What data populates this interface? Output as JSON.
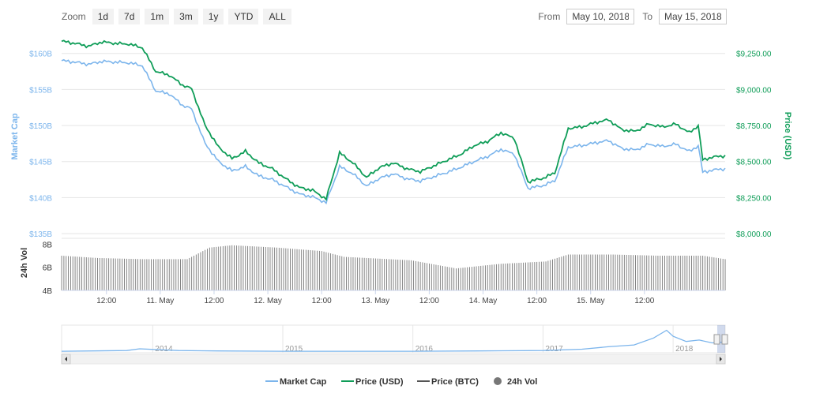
{
  "toolbar": {
    "zoom_label": "Zoom",
    "zoom_buttons": [
      "1d",
      "7d",
      "1m",
      "3m",
      "1y",
      "YTD",
      "ALL"
    ],
    "from_label": "From",
    "from_value": "May 10, 2018",
    "to_label": "To",
    "to_value": "May 15, 2018"
  },
  "colors": {
    "market_cap": "#7cb5ec",
    "price_usd": "#0f9d58",
    "price_btc": "#555555",
    "volume": "#777777",
    "grid": "#e6e6e6"
  },
  "chart_data": {
    "type": "line",
    "title": "",
    "axes": {
      "left_title": "Market Cap",
      "right_title": "Price (USD)",
      "volume_title": "24h Vol",
      "left_ticks": [
        "$160B",
        "$155B",
        "$150B",
        "$145B",
        "$140B",
        "$135B"
      ],
      "left_tick_values": [
        160,
        155,
        150,
        145,
        140,
        135
      ],
      "right_ticks": [
        "$9,250.00",
        "$9,000.00",
        "$8,750.00",
        "$8,500.00",
        "$8,250.00",
        "$8,000.00"
      ],
      "right_tick_values": [
        9250,
        9000,
        8750,
        8500,
        8250,
        8000
      ],
      "volume_ticks": [
        "8B",
        "6B",
        "4B"
      ],
      "volume_tick_values": [
        8,
        6,
        4
      ],
      "x_ticks": [
        "12:00",
        "11. May",
        "12:00",
        "12. May",
        "12:00",
        "13. May",
        "12:00",
        "14. May",
        "12:00",
        "15. May",
        "12:00"
      ],
      "x_tick_hours": [
        12,
        24,
        36,
        48,
        60,
        72,
        84,
        96,
        108,
        120,
        132
      ],
      "x_range_hours": [
        2,
        150
      ],
      "price_range": [
        8000,
        9380
      ],
      "volume_range": [
        4,
        8.5
      ],
      "grid": true
    },
    "series": [
      {
        "name": "Price (USD)",
        "x_hours": [
          2,
          5,
          8,
          11,
          14,
          17,
          20,
          23,
          26,
          29,
          31,
          34,
          37,
          40,
          43,
          46,
          49,
          52,
          55,
          58,
          61,
          64,
          67,
          70,
          73,
          76,
          79,
          82,
          85,
          88,
          91,
          94,
          97,
          100,
          103,
          106,
          109,
          112,
          115,
          118,
          121,
          124,
          127,
          130,
          133,
          136,
          139,
          142,
          144,
          145,
          147,
          150
        ],
        "values": [
          9335,
          9320,
          9300,
          9330,
          9320,
          9315,
          9290,
          9125,
          9100,
          9030,
          9005,
          8750,
          8600,
          8520,
          8570,
          8490,
          8450,
          8380,
          8320,
          8300,
          8240,
          8560,
          8490,
          8390,
          8460,
          8490,
          8450,
          8430,
          8470,
          8510,
          8550,
          8610,
          8640,
          8700,
          8660,
          8360,
          8380,
          8420,
          8730,
          8740,
          8770,
          8790,
          8720,
          8710,
          8760,
          8740,
          8760,
          8700,
          8750,
          8510,
          8530,
          8540
        ]
      },
      {
        "name": "Market Cap",
        "x_hours": [
          2,
          5,
          8,
          11,
          14,
          17,
          20,
          23,
          26,
          29,
          31,
          34,
          37,
          40,
          43,
          46,
          49,
          52,
          55,
          58,
          61,
          64,
          67,
          70,
          73,
          76,
          79,
          82,
          85,
          88,
          91,
          94,
          97,
          100,
          103,
          106,
          109,
          112,
          115,
          118,
          121,
          124,
          127,
          130,
          133,
          136,
          139,
          142,
          144,
          145,
          147,
          150
        ],
        "values": [
          159.0,
          158.8,
          158.5,
          158.9,
          158.8,
          158.7,
          158.3,
          154.8,
          154.4,
          152.8,
          152.3,
          147.5,
          145.0,
          143.7,
          144.3,
          143.0,
          142.5,
          141.5,
          140.5,
          140.1,
          139.3,
          144.3,
          143.3,
          141.6,
          142.7,
          143.3,
          142.6,
          142.3,
          142.9,
          143.5,
          144.2,
          145.0,
          145.7,
          146.7,
          146.0,
          141.3,
          141.6,
          142.3,
          147.0,
          147.2,
          147.6,
          147.9,
          146.8,
          146.6,
          147.4,
          147.1,
          147.4,
          146.4,
          147.2,
          143.5,
          143.8,
          144.0
        ]
      },
      {
        "name": "Price (BTC)",
        "values": []
      },
      {
        "name": "24h Vol",
        "type": "bar",
        "x_hours": [
          2,
          10,
          20,
          30,
          35,
          40,
          50,
          60,
          65,
          70,
          80,
          90,
          100,
          110,
          115,
          125,
          135,
          145,
          150
        ],
        "values": [
          7.0,
          6.8,
          6.7,
          6.7,
          7.7,
          7.9,
          7.7,
          7.4,
          6.9,
          6.8,
          6.6,
          5.9,
          6.3,
          6.5,
          7.1,
          7.1,
          7.0,
          7.0,
          6.7
        ]
      }
    ],
    "legend": {
      "position": "bottom-center",
      "items": [
        "Market Cap",
        "Price (USD)",
        "Price (BTC)",
        "24h Vol"
      ]
    },
    "navigator": {
      "year_labels": [
        "2014",
        "2015",
        "2016",
        "2017",
        "2018"
      ],
      "year_positions": [
        2014,
        2015,
        2016,
        2017,
        2018
      ],
      "range_years": [
        2013.3,
        2018.4
      ],
      "history_x": [
        2013.3,
        2013.8,
        2013.9,
        2014.2,
        2014.5,
        2015.0,
        2015.5,
        2016.0,
        2016.5,
        2017.0,
        2017.3,
        2017.5,
        2017.7,
        2017.85,
        2017.95,
        2018.0,
        2018.1,
        2018.2,
        2018.3,
        2018.37,
        2018.4
      ],
      "history_y": [
        2,
        4,
        9,
        4,
        3,
        2,
        2,
        2,
        3,
        4,
        8,
        15,
        20,
        40,
        62,
        45,
        30,
        34,
        26,
        28,
        26
      ]
    }
  }
}
